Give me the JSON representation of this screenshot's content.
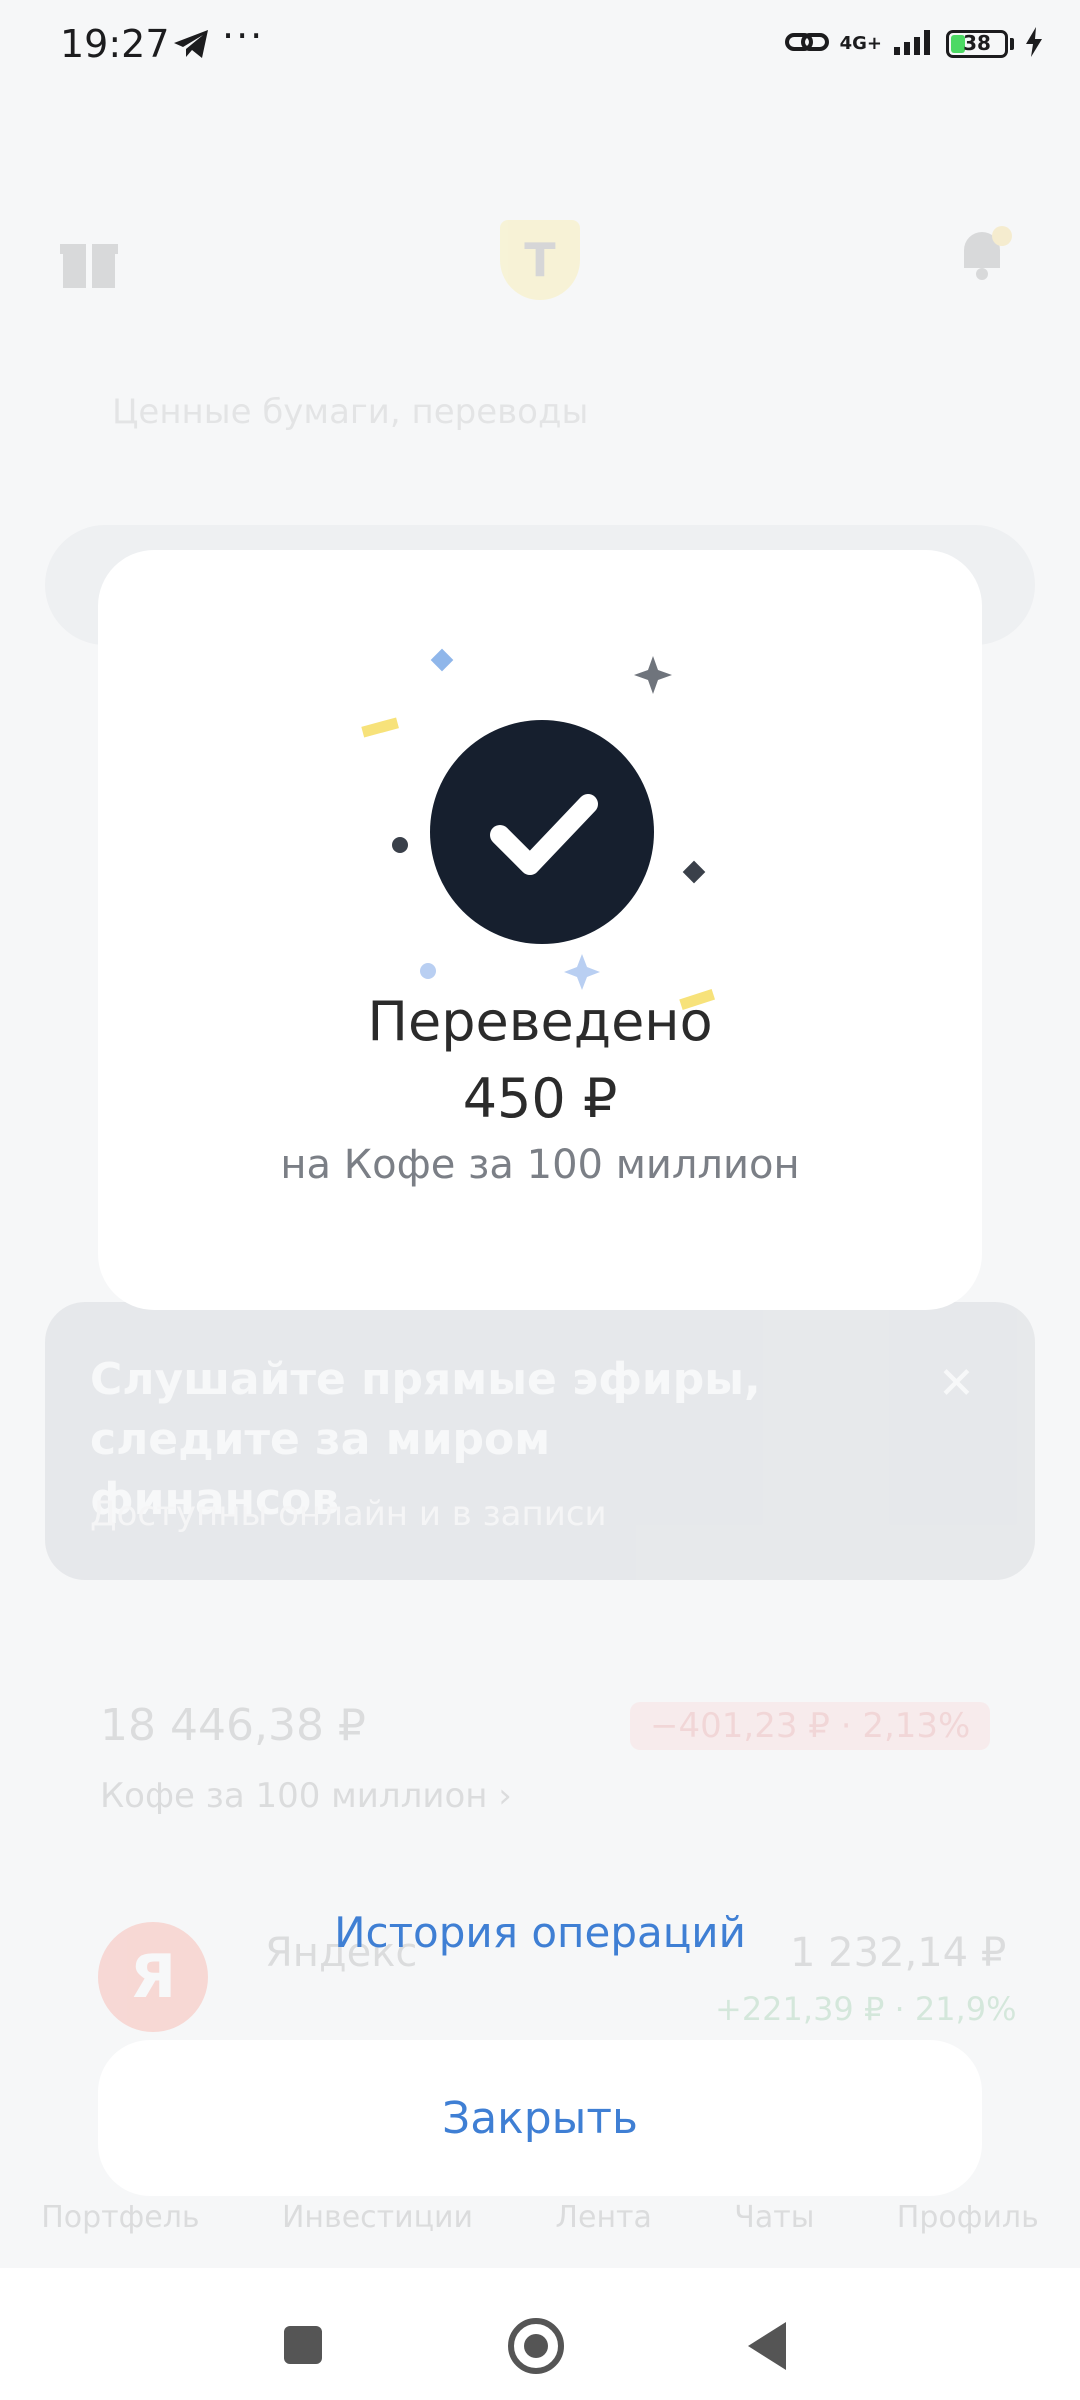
{
  "status_bar": {
    "time": "19:27",
    "dots": "···",
    "network": "4G+",
    "battery": "38"
  },
  "background_app": {
    "logo_letter": "T",
    "search_placeholder": "Ценные бумаги, переводы",
    "promo": {
      "title": "Слушайте прямые эфиры, следите за миром финансов",
      "subtitle": "Доступны онлайн и в записи"
    },
    "portfolio": {
      "sum": "18 446,38 ₽",
      "change": "−401,23 ₽ · 2,13%",
      "name": "Кофе за 100 миллион ›"
    },
    "asset": {
      "logo": "Я",
      "name": "Яндекс",
      "price": "1 232,14 ₽",
      "change": "+221,39 ₽ · 21,9%"
    },
    "tabs": [
      "Портфель",
      "Инвестиции",
      "Лента",
      "Чаты",
      "Профиль"
    ]
  },
  "success": {
    "title": "Переведено",
    "amount": "450 ₽",
    "subtitle": "на Кофе за 100 миллион"
  },
  "actions": {
    "history_label": "История операций",
    "close_label": "Закрыть"
  },
  "colors": {
    "accent": "#3f7fd4",
    "check_circle": "#161f2e",
    "card": "#ffffff"
  }
}
